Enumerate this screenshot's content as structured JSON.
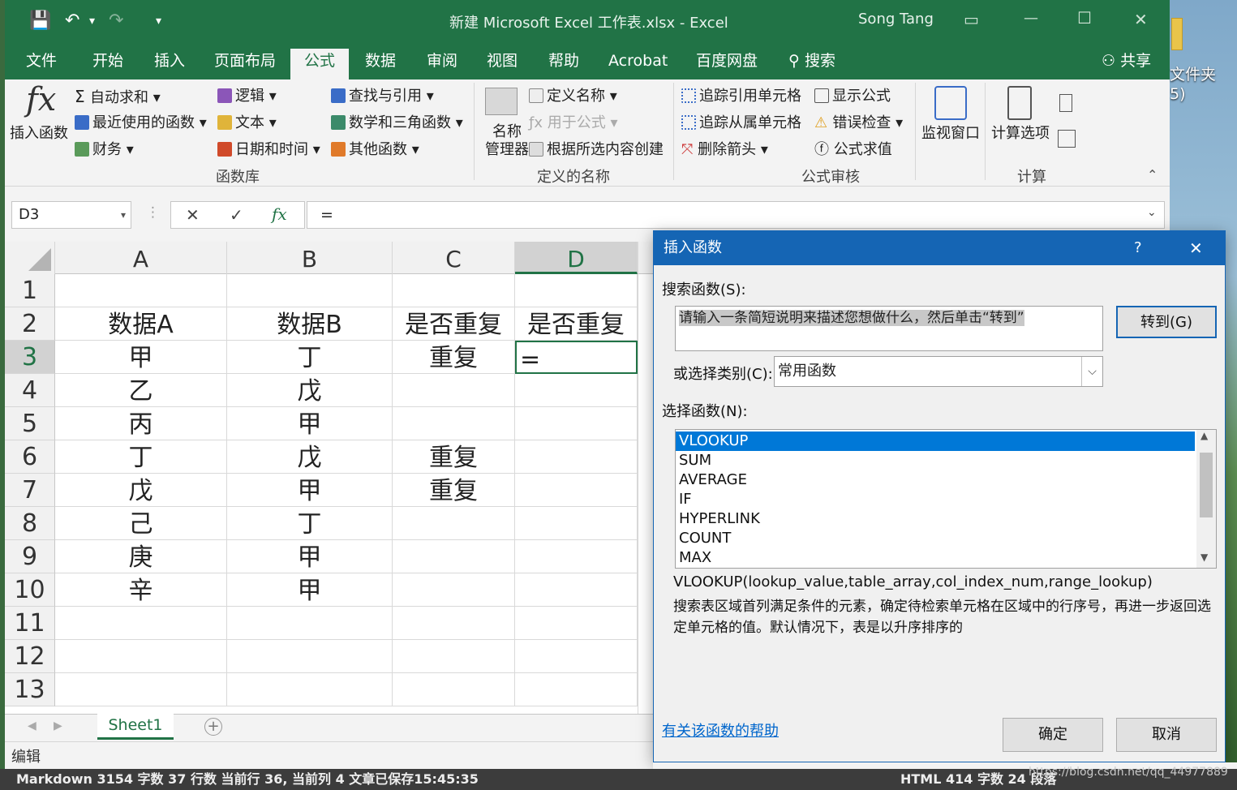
{
  "desktop": {
    "label_line1": "文件夹",
    "label_line2": "5)"
  },
  "titlebar": {
    "title": "新建 Microsoft Excel 工作表.xlsx  -  Excel",
    "user": "Song Tang",
    "save_icon": "💾",
    "undo_icon": "↶",
    "redo_icon": "↷",
    "customize_icon": "▾",
    "ribbon_display_icon": "▭",
    "minimize_icon": "—",
    "maximize_icon": "☐",
    "close_icon": "✕"
  },
  "tabs": [
    "文件",
    "开始",
    "插入",
    "页面布局",
    "公式",
    "数据",
    "审阅",
    "视图",
    "帮助",
    "Acrobat",
    "百度网盘"
  ],
  "search_tab": "搜索",
  "share": "共享",
  "ribbon": {
    "insert_function_symbol": "fx",
    "insert_function": "插入函数",
    "autosum": "自动求和",
    "recent": "最近使用的函数",
    "financial": "财务",
    "logical": "逻辑",
    "text": "文本",
    "datetime": "日期和时间",
    "lookup": "查找与引用",
    "math": "数学和三角函数",
    "other": "其他函数",
    "group_library": "函数库",
    "name_mgr_1": "名称",
    "name_mgr_2": "管理器",
    "define_name": "定义名称",
    "use_in_formula": "用于公式",
    "create_from_sel": "根据所选内容创建",
    "group_names": "定义的名称",
    "trace_prec": "追踪引用单元格",
    "trace_dep": "追踪从属单元格",
    "remove_arrows": "删除箭头",
    "show_formulas": "显示公式",
    "error_check": "错误检查",
    "eval_formula": "公式求值",
    "group_audit": "公式审核",
    "watch_window": "监视窗口",
    "calc_options": "计算选项",
    "group_calc": "计算"
  },
  "formula_bar": {
    "name_box": "D3",
    "cancel": "✕",
    "enter": "✓",
    "fx": "fx",
    "formula": "="
  },
  "columns": [
    "A",
    "B",
    "C",
    "D"
  ],
  "rows": [
    "1",
    "2",
    "3",
    "4",
    "5",
    "6",
    "7",
    "8",
    "9",
    "10",
    "11",
    "12",
    "13"
  ],
  "cells": [
    [
      "",
      "",
      "",
      ""
    ],
    [
      "数据A",
      "数据B",
      "是否重复",
      "是否重复"
    ],
    [
      "甲",
      "丁",
      "重复",
      "="
    ],
    [
      "乙",
      "戊",
      "",
      ""
    ],
    [
      "丙",
      "甲",
      "",
      ""
    ],
    [
      "丁",
      "戊",
      "重复",
      ""
    ],
    [
      "戊",
      "甲",
      "重复",
      ""
    ],
    [
      "己",
      "丁",
      "",
      ""
    ],
    [
      "庚",
      "甲",
      "",
      ""
    ],
    [
      "辛",
      "甲",
      "",
      ""
    ],
    [
      "",
      "",
      "",
      ""
    ],
    [
      "",
      "",
      "",
      ""
    ],
    [
      "",
      "",
      "",
      ""
    ]
  ],
  "sheet_tab": "Sheet1",
  "status": "编辑",
  "dialog": {
    "title": "插入函数",
    "help_btn": "?",
    "close_btn": "✕",
    "search_label": "搜索函数(S):",
    "search_value": "请输入一条简短说明来描述您想做什么，然后单击“转到”",
    "go": "转到(G)",
    "category_label": "或选择类别(C):",
    "category_value": "常用函数",
    "select_label": "选择函数(N):",
    "functions": [
      "VLOOKUP",
      "SUM",
      "AVERAGE",
      "IF",
      "HYPERLINK",
      "COUNT",
      "MAX"
    ],
    "signature": "VLOOKUP(lookup_value,table_array,col_index_num,range_lookup)",
    "description": "搜索表区域首列满足条件的元素，确定待检索单元格在区域中的行序号，再进一步返回选定单元格的值。默认情况下，表是以升序排序的",
    "help_link": "有关该函数的帮助",
    "ok": "确定",
    "cancel": "取消"
  },
  "bottom_strip": "Markdown  3154 字数  37 行数  当前行 36, 当前列 4  文章已保存15:45:35",
  "bottom_right": "HTML  414 字数  24 段落",
  "watermark": "https://blog.csdn.net/qq_44977889"
}
